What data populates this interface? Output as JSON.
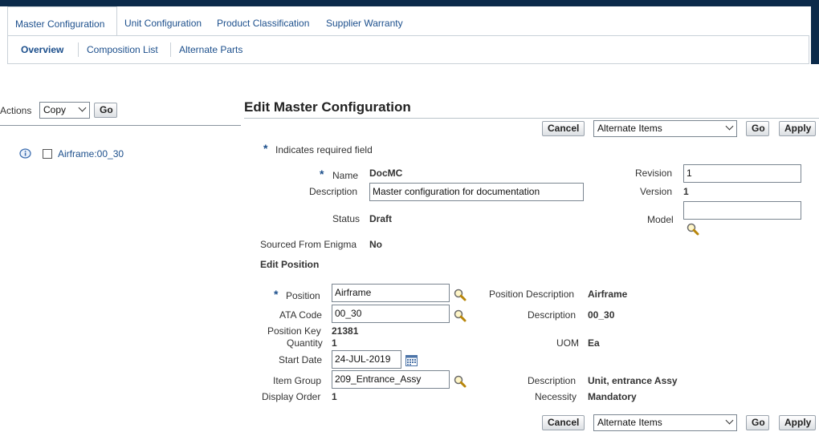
{
  "tabs": [
    {
      "label": "Master Configuration"
    },
    {
      "label": "Unit Configuration"
    },
    {
      "label": "Product Classification"
    },
    {
      "label": "Supplier Warranty"
    }
  ],
  "subtabs": [
    {
      "label": "Overview"
    },
    {
      "label": "Composition List"
    },
    {
      "label": "Alternate Parts"
    }
  ],
  "left": {
    "actions_label": "Actions",
    "actions_value": "Copy",
    "go_label": "Go",
    "tree_item": "Airframe:00_30"
  },
  "page": {
    "title": "Edit Master Configuration",
    "cancel_label": "Cancel",
    "alternate_value": "Alternate Items",
    "go_label": "Go",
    "apply_label": "Apply",
    "required_marker": "*",
    "required_note": "Indicates required field"
  },
  "header_fields": {
    "name_label": "Name",
    "name_value": "DocMC",
    "description_label": "Description",
    "description_value": "Master configuration for documentation",
    "status_label": "Status",
    "status_value": "Draft",
    "sourced_label": "Sourced From Enigma",
    "sourced_value": "No",
    "revision_label": "Revision",
    "revision_value": "1",
    "version_label": "Version",
    "version_value": "1",
    "model_label": "Model",
    "model_value": ""
  },
  "position": {
    "section_title": "Edit Position",
    "position_label": "Position",
    "position_value": "Airframe",
    "ata_label": "ATA Code",
    "ata_value": "00_30",
    "key_label": "Position Key",
    "key_value": "21381",
    "quantity_label": "Quantity",
    "quantity_value": "1",
    "start_label": "Start Date",
    "start_value": "24-JUL-2019",
    "item_group_label": "Item Group",
    "item_group_value": "209_Entrance_Assy",
    "display_order_label": "Display Order",
    "display_order_value": "1",
    "pos_desc_label": "Position Description",
    "pos_desc_value": "Airframe",
    "desc_label": "Description",
    "desc_value": "00_30",
    "uom_label": "UOM",
    "uom_value": "Ea",
    "item_desc_label": "Description",
    "item_desc_value": "Unit, entrance Assy",
    "necessity_label": "Necessity",
    "necessity_value": "Mandatory"
  }
}
